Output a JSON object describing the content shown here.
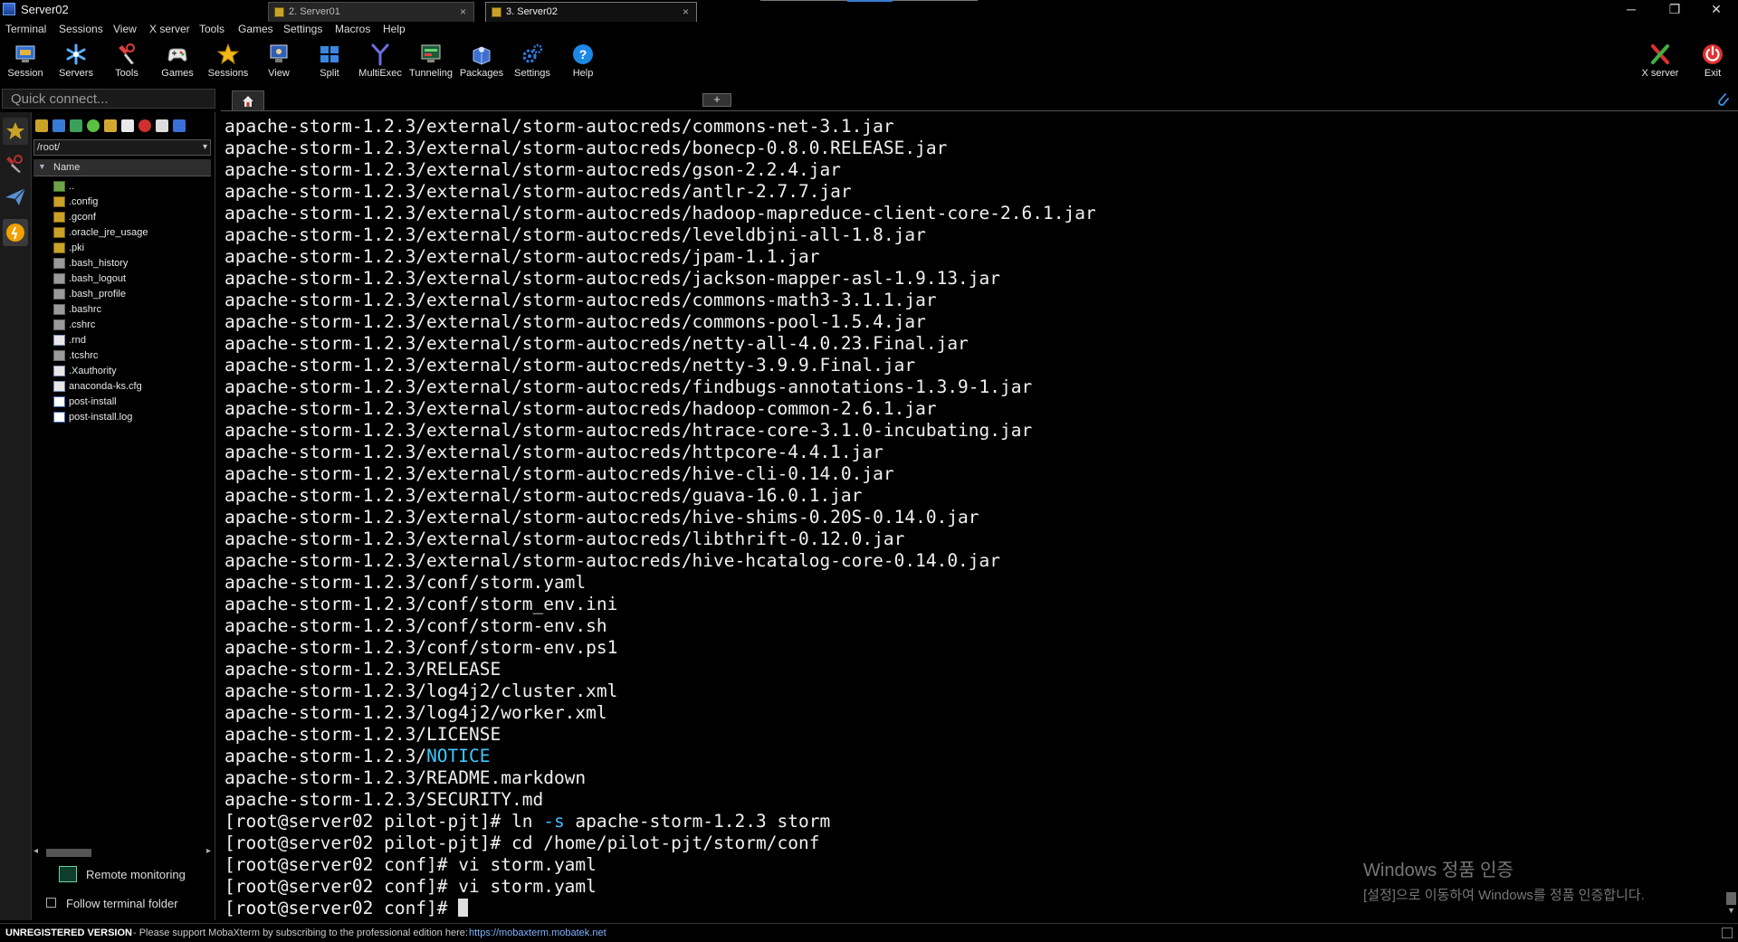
{
  "window": {
    "title": "Server02"
  },
  "window_controls": {
    "minimize": "─",
    "restore": "❐",
    "close": "✕"
  },
  "menu": [
    "Terminal",
    "Sessions",
    "View",
    "X server",
    "Tools",
    "Games",
    "Settings",
    "Macros",
    "Help"
  ],
  "toolbar": {
    "left": [
      {
        "label": "Session",
        "icon": "session-icon"
      },
      {
        "label": "Servers",
        "icon": "servers-icon"
      },
      {
        "label": "Tools",
        "icon": "tools-icon"
      },
      {
        "label": "Games",
        "icon": "games-icon"
      },
      {
        "label": "Sessions",
        "icon": "star-icon"
      },
      {
        "label": "View",
        "icon": "view-icon"
      },
      {
        "label": "Split",
        "icon": "split-icon"
      },
      {
        "label": "MultiExec",
        "icon": "multiexec-icon"
      },
      {
        "label": "Tunneling",
        "icon": "tunneling-icon"
      },
      {
        "label": "Packages",
        "icon": "packages-icon"
      },
      {
        "label": "Settings",
        "icon": "settings-icon"
      },
      {
        "label": "Help",
        "icon": "help-icon"
      }
    ],
    "right": [
      {
        "label": "X server",
        "icon": "x-server-icon"
      },
      {
        "label": "Exit",
        "icon": "power-icon"
      }
    ]
  },
  "quick_connect": {
    "placeholder": "Quick connect..."
  },
  "tabs": [
    {
      "label": "2. Server01",
      "close": "×",
      "active": false
    },
    {
      "label": "3. Server02",
      "close": "×",
      "active": true
    }
  ],
  "new_tab": {
    "label": "+"
  },
  "file_browser": {
    "path": "/root/",
    "caret": "▾",
    "column_header": "Name",
    "sort_glyph": "▼",
    "files": [
      {
        "name": "..",
        "type": "up"
      },
      {
        "name": ".config",
        "type": "folder"
      },
      {
        "name": ".gconf",
        "type": "folder"
      },
      {
        "name": ".oracle_jre_usage",
        "type": "folder"
      },
      {
        "name": ".pki",
        "type": "folder"
      },
      {
        "name": ".bash_history",
        "type": "file"
      },
      {
        "name": ".bash_logout",
        "type": "file"
      },
      {
        "name": ".bash_profile",
        "type": "file"
      },
      {
        "name": ".bashrc",
        "type": "file"
      },
      {
        "name": ".cshrc",
        "type": "file"
      },
      {
        "name": ".rnd",
        "type": "doc"
      },
      {
        "name": ".tcshrc",
        "type": "file"
      },
      {
        "name": ".Xauthority",
        "type": "doc"
      },
      {
        "name": "anaconda-ks.cfg",
        "type": "doc"
      },
      {
        "name": "post-install",
        "type": "text"
      },
      {
        "name": "post-install.log",
        "type": "text"
      }
    ],
    "remote_monitoring": "Remote monitoring",
    "follow_terminal_folder": "Follow terminal folder"
  },
  "terminal": {
    "lines": [
      {
        "text": "apache-storm-1.2.3/external/storm-autocreds/commons-net-3.1.jar"
      },
      {
        "text": "apache-storm-1.2.3/external/storm-autocreds/bonecp-0.8.0.RELEASE.jar"
      },
      {
        "text": "apache-storm-1.2.3/external/storm-autocreds/gson-2.2.4.jar"
      },
      {
        "text": "apache-storm-1.2.3/external/storm-autocreds/antlr-2.7.7.jar"
      },
      {
        "text": "apache-storm-1.2.3/external/storm-autocreds/hadoop-mapreduce-client-core-2.6.1.jar"
      },
      {
        "text": "apache-storm-1.2.3/external/storm-autocreds/leveldbjni-all-1.8.jar"
      },
      {
        "text": "apache-storm-1.2.3/external/storm-autocreds/jpam-1.1.jar"
      },
      {
        "text": "apache-storm-1.2.3/external/storm-autocreds/jackson-mapper-asl-1.9.13.jar"
      },
      {
        "text": "apache-storm-1.2.3/external/storm-autocreds/commons-math3-3.1.1.jar"
      },
      {
        "text": "apache-storm-1.2.3/external/storm-autocreds/commons-pool-1.5.4.jar"
      },
      {
        "text": "apache-storm-1.2.3/external/storm-autocreds/netty-all-4.0.23.Final.jar"
      },
      {
        "text": "apache-storm-1.2.3/external/storm-autocreds/netty-3.9.9.Final.jar"
      },
      {
        "text": "apache-storm-1.2.3/external/storm-autocreds/findbugs-annotations-1.3.9-1.jar"
      },
      {
        "text": "apache-storm-1.2.3/external/storm-autocreds/hadoop-common-2.6.1.jar"
      },
      {
        "text": "apache-storm-1.2.3/external/storm-autocreds/htrace-core-3.1.0-incubating.jar"
      },
      {
        "text": "apache-storm-1.2.3/external/storm-autocreds/httpcore-4.4.1.jar"
      },
      {
        "text": "apache-storm-1.2.3/external/storm-autocreds/hive-cli-0.14.0.jar"
      },
      {
        "text": "apache-storm-1.2.3/external/storm-autocreds/guava-16.0.1.jar"
      },
      {
        "text": "apache-storm-1.2.3/external/storm-autocreds/hive-shims-0.20S-0.14.0.jar"
      },
      {
        "text": "apache-storm-1.2.3/external/storm-autocreds/libthrift-0.12.0.jar"
      },
      {
        "text": "apache-storm-1.2.3/external/storm-autocreds/hive-hcatalog-core-0.14.0.jar"
      },
      {
        "text": "apache-storm-1.2.3/conf/storm.yaml"
      },
      {
        "text": "apache-storm-1.2.3/conf/storm_env.ini"
      },
      {
        "text": "apache-storm-1.2.3/conf/storm-env.sh"
      },
      {
        "text": "apache-storm-1.2.3/conf/storm-env.ps1"
      },
      {
        "text": "apache-storm-1.2.3/RELEASE"
      },
      {
        "text": "apache-storm-1.2.3/log4j2/cluster.xml"
      },
      {
        "text": "apache-storm-1.2.3/log4j2/worker.xml"
      },
      {
        "text": "apache-storm-1.2.3/LICENSE"
      },
      {
        "text": "apache-storm-1.2.3/",
        "highlight": "NOTICE"
      },
      {
        "text": "apache-storm-1.2.3/README.markdown"
      },
      {
        "text": "apache-storm-1.2.3/SECURITY.md"
      },
      {
        "text": "[root@server02 pilot-pjt]# ln ",
        "flag": "-s",
        "rest": " apache-storm-1.2.3 storm"
      },
      {
        "text": "[root@server02 pilot-pjt]# cd /home/pilot-pjt/storm/conf"
      },
      {
        "text": "[root@server02 conf]# vi storm.yaml"
      },
      {
        "text": "[root@server02 conf]# vi storm.yaml"
      },
      {
        "text": "[root@server02 conf]# ",
        "cursor": true
      }
    ]
  },
  "watermark": {
    "line1": "Windows 정품 인증",
    "line2": "[설정]으로 이동하여 Windows를 정품 인증합니다."
  },
  "status": {
    "unregistered": "UNREGISTERED VERSION",
    "support": " -  Please support MobaXterm by subscribing to the professional edition here:",
    "url": "https://mobaxterm.mobatek.net"
  },
  "colors": {
    "background": "#000000",
    "terminal_text": "#f0f0f0",
    "highlight": "#3ec9ff",
    "accent_red": "#e03030",
    "accent_blue": "#2d7be0"
  }
}
